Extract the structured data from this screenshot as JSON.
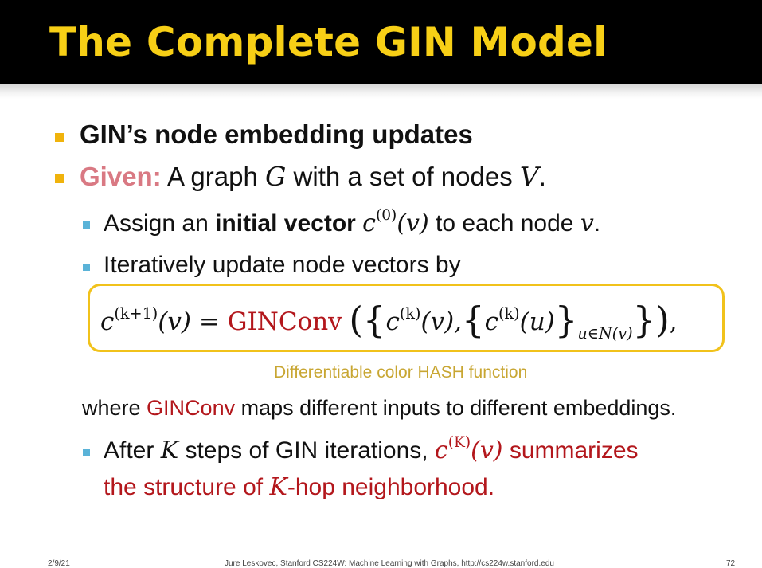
{
  "slide": {
    "title": "The Complete GIN Model"
  },
  "bullets": {
    "b1": "GIN’s node embedding updates",
    "b2_label": "Given:",
    "b2_text_a": " A graph ",
    "b2_G": "G",
    "b2_text_b": " with a set of nodes ",
    "b2_V": "V",
    "b2_end": ".",
    "s1_a": "Assign an ",
    "s1_bold": "initial vector",
    "s1_c": "c",
    "s1_sup": "(0)",
    "s1_arg": "(v)",
    "s1_b": " to each node ",
    "s1_v": "v",
    "s1_end": ".",
    "s2": "Iteratively update node vectors by"
  },
  "equation": {
    "lhs_c": "c",
    "lhs_sup": "(k+1)",
    "lhs_arg": "(v)",
    "eq": " = ",
    "func": "GINConv",
    "open": "(",
    "lbrace": "{",
    "t1_c": "c",
    "t1_sup": "(k)",
    "t1_arg": "(v),",
    "lbrace2": "{",
    "t2_c": "c",
    "t2_sup": "(k)",
    "t2_arg": "(u)",
    "rbrace2": "}",
    "t2_sub": "u∈N(v)",
    "rbrace": "}",
    "close": ")",
    "comma": ","
  },
  "hash_label": "Differentiable color HASH function",
  "where_line": {
    "a": "where ",
    "func": "GINConv",
    "b": " maps different inputs to different embeddings."
  },
  "after": {
    "a": "After ",
    "K": "K",
    "b": " steps of GIN iterations, ",
    "c": "c",
    "sup": "(K)",
    "arg": "(v)",
    "d": " summarizes",
    "line2_a": "the structure of ",
    "line2_K": "K",
    "line2_b": "-hop neighborhood."
  },
  "footer": {
    "date": "2/9/21",
    "course": "Jure Leskovec, Stanford CS224W: Machine Learning with Graphs, http://cs224w.stanford.edu",
    "page": "72"
  },
  "colors": {
    "title": "#f7cf16",
    "given": "#d97983",
    "accent_red": "#b3171c",
    "box_border": "#f1c21b",
    "hash_label": "#c8a632"
  }
}
